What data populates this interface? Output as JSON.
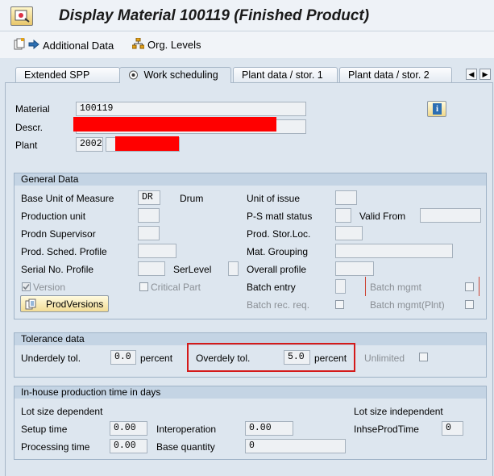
{
  "window": {
    "title": "Display Material 100119 (Finished Product)"
  },
  "toolbar": {
    "additional_data": "Additional Data",
    "org_levels": "Org. Levels"
  },
  "tabs": [
    "Extended SPP",
    "Work scheduling",
    "Plant data / stor. 1",
    "Plant data / stor. 2"
  ],
  "header": {
    "material_label": "Material",
    "material_value": "100119",
    "descr_label": "Descr.",
    "plant_label": "Plant",
    "plant_value": "2002"
  },
  "general": {
    "title": "General Data",
    "base_uom_label": "Base Unit of Measure",
    "base_uom_value": "DR",
    "base_uom_text": "Drum",
    "unit_of_issue": "Unit of issue",
    "production_unit": "Production unit",
    "ps_status": "P-S matl status",
    "valid_from": "Valid From",
    "prodn_supervisor": "Prodn Supervisor",
    "prod_stor_loc": "Prod. Stor.Loc.",
    "prod_sched_profile": "Prod. Sched. Profile",
    "mat_grouping": "Mat. Grouping",
    "serial_profile": "Serial No. Profile",
    "ser_level": "SerLevel",
    "overall_profile": "Overall profile",
    "version": "Version",
    "critical_part": "Critical Part",
    "batch_entry": "Batch entry",
    "batch_mgmt": "Batch mgmt",
    "prod_versions": "ProdVersions",
    "batch_rec_req": "Batch rec. req.",
    "batch_mgmt_plnt": "Batch mgmt(Plnt)"
  },
  "tolerance": {
    "title": "Tolerance data",
    "underdely_label": "Underdely tol.",
    "underdely_value": "0.0",
    "overdely_label": "Overdely tol.",
    "overdely_value": "5.0",
    "percent": "percent",
    "unlimited": "Unlimited"
  },
  "inhouse": {
    "title": "In-house production time in days",
    "lot_dependent": "Lot size dependent",
    "lot_independent": "Lot size independent",
    "setup_label": "Setup time",
    "setup_value": "0.00",
    "interop_label": "Interoperation",
    "interop_value": "0.00",
    "inhse_label": "InhseProdTime",
    "inhse_value": "0",
    "processing_label": "Processing time",
    "processing_value": "0.00",
    "base_qty_label": "Base quantity",
    "base_qty_value": "0"
  },
  "colors": {
    "accent": "#d41a1a",
    "redaction": "#ff0000",
    "group_header": "#c4d4e4"
  }
}
